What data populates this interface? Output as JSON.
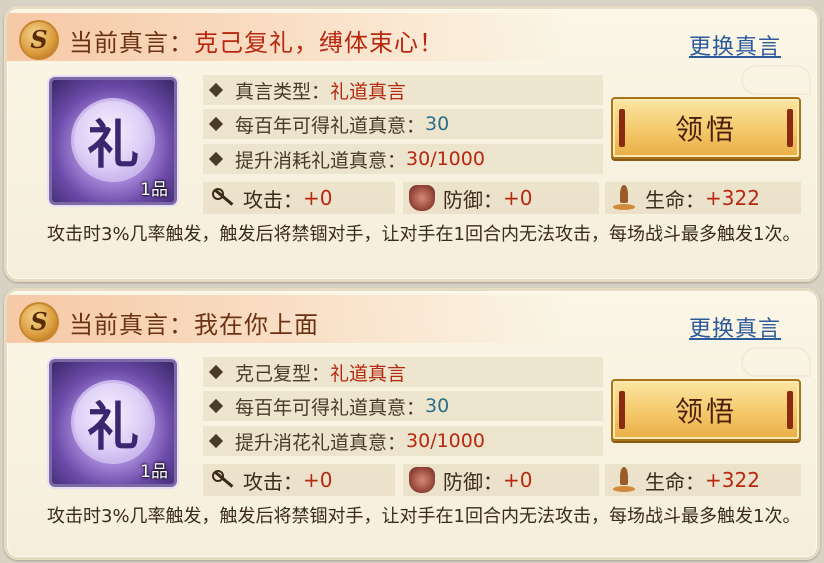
{
  "panels": [
    {
      "header": {
        "logo_glyph": "S",
        "label": "当前真言：",
        "motto": "克己复礼，缚体束心！",
        "change_link": "更换真言"
      },
      "skill": {
        "glyph": "礼",
        "grade": "1品"
      },
      "info": [
        {
          "label": "真言类型：",
          "value": "礼道真言"
        },
        {
          "label": "每百年可得礼道真意：",
          "value": "30"
        },
        {
          "label": "提升消耗礼道真意：",
          "value": "30/1000"
        }
      ],
      "comprehend_button": "领悟",
      "stats": [
        {
          "label": "攻击：",
          "value": "+0",
          "icon": "sword-icon"
        },
        {
          "label": "防御：",
          "value": "+0",
          "icon": "armor-icon"
        },
        {
          "label": "生命：",
          "value": "+322",
          "icon": "health-icon"
        }
      ],
      "description": "攻击时3%几率触发，触发后将禁锢对手，让对手在1回合内无法攻击，每场战斗最多触发1次。"
    },
    {
      "header": {
        "logo_glyph": "S",
        "label": "当前真言：",
        "motto": "我在你上面",
        "change_link": "更换真言"
      },
      "skill": {
        "glyph": "礼",
        "grade": "1品"
      },
      "info": [
        {
          "label": "克己复型：",
          "value": "礼道真言"
        },
        {
          "label": "每百年可得礼道真意：",
          "value": "30"
        },
        {
          "label": "提升消花礼道真意：",
          "value": "30/1000"
        }
      ],
      "comprehend_button": "领悟",
      "stats": [
        {
          "label": "攻击：",
          "value": "+0",
          "icon": "sword-icon"
        },
        {
          "label": "防御：",
          "value": "+0",
          "icon": "armor-icon"
        },
        {
          "label": "生命：",
          "value": "+322",
          "icon": "health-icon"
        }
      ],
      "description": "攻击时3%几率触发，触发后将禁锢对手，让对手在1回合内无法攻击，每场战斗最多触发1次。"
    }
  ]
}
